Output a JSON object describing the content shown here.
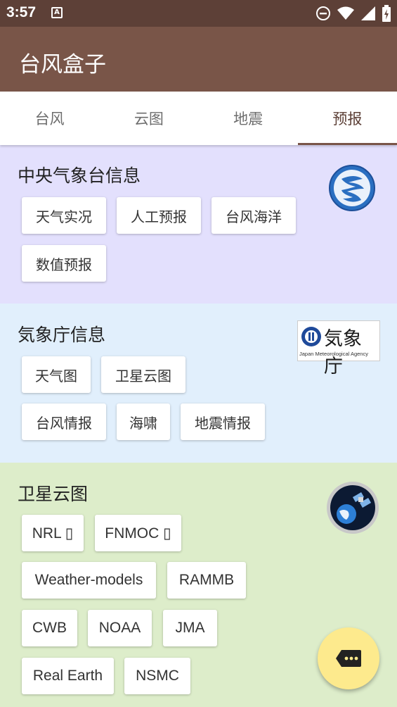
{
  "status_bar": {
    "time": "3:57",
    "notification_glyph": "A"
  },
  "app_bar": {
    "title": "台风盒子"
  },
  "tabs": [
    {
      "label": "台风"
    },
    {
      "label": "云图"
    },
    {
      "label": "地震"
    },
    {
      "label": "预报",
      "active": true
    }
  ],
  "sections": {
    "cma": {
      "title": "中央气象台信息",
      "chips": [
        "天气实况",
        "人工预报",
        "台风海洋",
        "数值预报"
      ]
    },
    "jma": {
      "title": "気象庁信息",
      "logo_text": "気象庁",
      "logo_subtext": "Japan Meteorological Agency",
      "chips": [
        "天气图",
        "卫星云图",
        "台风情报",
        "海啸",
        "地震情报"
      ]
    },
    "satellite": {
      "title": "卫星云图",
      "chips": [
        "NRL ▯",
        "FNMOC ▯",
        "Weather-models",
        "RAMMB",
        "CWB",
        "NOAA",
        "JMA",
        "Real Earth",
        "NSMC"
      ]
    }
  },
  "colors": {
    "status_bar": "#5d4037",
    "app_bar": "#795548",
    "cma_bg": "#e3e0fd",
    "jma_bg": "#e1effc",
    "satellite_bg": "#ddedca",
    "fab": "#fdea8d"
  },
  "icons": {
    "fab": "chat-bubble-more-icon",
    "cma_logo": "cma-logo-icon",
    "satellite_logo": "satellite-earth-icon"
  }
}
